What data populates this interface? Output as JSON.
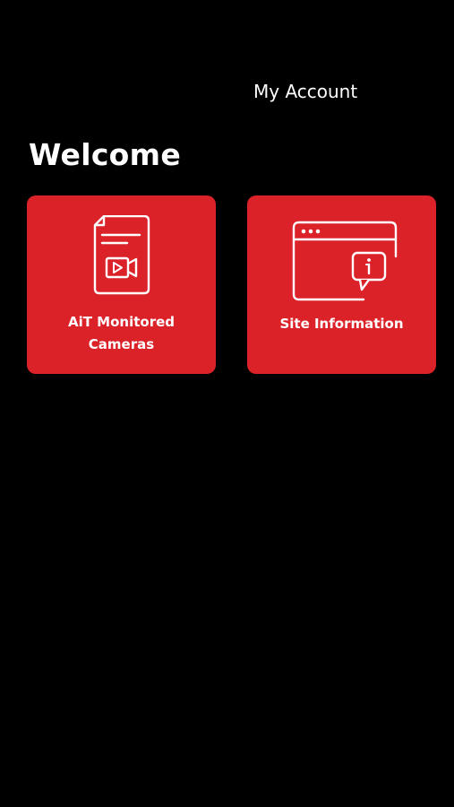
{
  "colors": {
    "background": "#000000",
    "tile": "#dc2229",
    "text": "#ffffff"
  },
  "header": {
    "account_link": "My Account"
  },
  "main": {
    "welcome": "Welcome",
    "tiles": [
      {
        "icon": "camera-document-icon",
        "label_line1": "AiT Monitored",
        "label_line2": "Cameras"
      },
      {
        "icon": "browser-info-icon",
        "label": "Site Information"
      }
    ]
  }
}
